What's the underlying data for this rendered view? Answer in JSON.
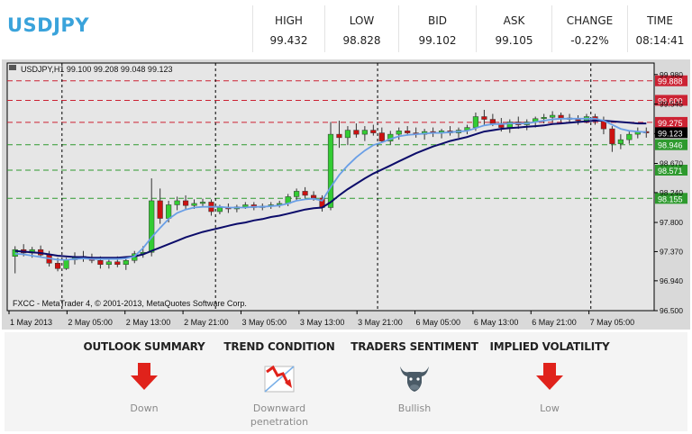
{
  "header": {
    "symbol": "USDJPY",
    "quotes": [
      {
        "label": "HIGH",
        "value": "99.432"
      },
      {
        "label": "LOW",
        "value": "98.828"
      },
      {
        "label": "BID",
        "value": "99.102"
      },
      {
        "label": "ASK",
        "value": "99.105"
      },
      {
        "label": "CHANGE",
        "value": "-0.22%"
      },
      {
        "label": "TIME",
        "value": "08:14:41"
      }
    ]
  },
  "chart_data": {
    "type": "candlestick",
    "info_line": "USDJPY,H1  99.100 99.208 99.048 99.123",
    "watermark": "FXCC - MetaTrader 4, © 2001-2013, MetaQuotes Software Corp.",
    "ylim": [
      96.5,
      100.15
    ],
    "yticks": [
      "99.980",
      "99.545",
      "99.110",
      "98.670",
      "98.240",
      "97.800",
      "97.370",
      "96.940",
      "96.500"
    ],
    "xticks": [
      "1 May 2013",
      "2 May 05:00",
      "2 May 13:00",
      "2 May 21:00",
      "3 May 05:00",
      "3 May 13:00",
      "3 May 21:00",
      "6 May 05:00",
      "6 May 13:00",
      "6 May 21:00",
      "7 May 05:00"
    ],
    "vlines": [
      "2 May 2013",
      "3 May 2013",
      "6 May 2013",
      "7 May 2013"
    ],
    "current_price": "99.123",
    "levels": [
      {
        "value": 99.888,
        "label": "99.888",
        "color": "#cc2233"
      },
      {
        "value": 99.6,
        "label": "99.600",
        "color": "#cc2233"
      },
      {
        "value": 99.275,
        "label": "99.275",
        "color": "#cc2233"
      },
      {
        "value": 98.946,
        "label": "98.946",
        "color": "#2e9a2e"
      },
      {
        "value": 98.571,
        "label": "98.571",
        "color": "#2e9a2e"
      },
      {
        "value": 98.155,
        "label": "98.155",
        "color": "#2e9a2e"
      }
    ],
    "ohlc": [
      [
        97.3,
        97.45,
        97.05,
        97.4
      ],
      [
        97.4,
        97.48,
        97.3,
        97.35
      ],
      [
        97.35,
        97.44,
        97.28,
        97.4
      ],
      [
        97.4,
        97.46,
        97.3,
        97.32
      ],
      [
        97.32,
        97.38,
        97.15,
        97.2
      ],
      [
        97.2,
        97.28,
        97.08,
        97.12
      ],
      [
        97.12,
        97.28,
        97.1,
        97.25
      ],
      [
        97.25,
        97.36,
        97.18,
        97.3
      ],
      [
        97.3,
        97.38,
        97.22,
        97.28
      ],
      [
        97.28,
        97.34,
        97.2,
        97.24
      ],
      [
        97.24,
        97.3,
        97.12,
        97.18
      ],
      [
        97.18,
        97.26,
        97.12,
        97.22
      ],
      [
        97.22,
        97.3,
        97.14,
        97.18
      ],
      [
        97.18,
        97.28,
        97.1,
        97.24
      ],
      [
        97.24,
        97.38,
        97.2,
        97.34
      ],
      [
        97.34,
        97.45,
        97.28,
        97.36
      ],
      [
        97.36,
        98.45,
        97.3,
        98.12
      ],
      [
        98.12,
        98.3,
        97.78,
        97.86
      ],
      [
        97.86,
        98.12,
        97.8,
        98.06
      ],
      [
        98.06,
        98.18,
        97.98,
        98.12
      ],
      [
        98.12,
        98.2,
        98.0,
        98.05
      ],
      [
        98.05,
        98.14,
        98.0,
        98.08
      ],
      [
        98.08,
        98.15,
        98.02,
        98.1
      ],
      [
        98.1,
        98.14,
        97.9,
        97.96
      ],
      [
        97.96,
        98.06,
        97.92,
        98.02
      ],
      [
        98.02,
        98.08,
        97.94,
        98.0
      ],
      [
        98.0,
        98.06,
        97.95,
        98.03
      ],
      [
        98.03,
        98.1,
        98.0,
        98.06
      ],
      [
        98.06,
        98.1,
        97.98,
        98.02
      ],
      [
        98.02,
        98.08,
        97.98,
        98.04
      ],
      [
        98.04,
        98.1,
        98.0,
        98.06
      ],
      [
        98.06,
        98.12,
        98.02,
        98.08
      ],
      [
        98.08,
        98.22,
        98.04,
        98.18
      ],
      [
        98.18,
        98.3,
        98.12,
        98.26
      ],
      [
        98.26,
        98.32,
        98.16,
        98.2
      ],
      [
        98.2,
        98.26,
        98.12,
        98.16
      ],
      [
        98.16,
        98.2,
        97.96,
        98.02
      ],
      [
        98.02,
        99.28,
        97.98,
        99.1
      ],
      [
        99.1,
        99.3,
        98.9,
        99.05
      ],
      [
        99.05,
        99.22,
        98.94,
        99.16
      ],
      [
        99.16,
        99.26,
        99.05,
        99.1
      ],
      [
        99.1,
        99.22,
        99.0,
        99.16
      ],
      [
        99.16,
        99.24,
        99.08,
        99.12
      ],
      [
        99.12,
        99.2,
        98.98,
        99.0
      ],
      [
        99.0,
        99.15,
        98.95,
        99.1
      ],
      [
        99.1,
        99.2,
        99.02,
        99.15
      ],
      [
        99.15,
        99.22,
        99.08,
        99.12
      ],
      [
        99.12,
        99.2,
        99.05,
        99.1
      ],
      [
        99.1,
        99.18,
        99.02,
        99.14
      ],
      [
        99.14,
        99.2,
        99.06,
        99.12
      ],
      [
        99.12,
        99.18,
        99.04,
        99.15
      ],
      [
        99.15,
        99.22,
        99.08,
        99.12
      ],
      [
        99.12,
        99.2,
        99.05,
        99.16
      ],
      [
        99.16,
        99.24,
        99.1,
        99.2
      ],
      [
        99.2,
        99.42,
        99.15,
        99.36
      ],
      [
        99.36,
        99.46,
        99.24,
        99.32
      ],
      [
        99.32,
        99.4,
        99.22,
        99.26
      ],
      [
        99.26,
        99.34,
        99.14,
        99.2
      ],
      [
        99.2,
        99.32,
        99.12,
        99.28
      ],
      [
        99.28,
        99.36,
        99.18,
        99.24
      ],
      [
        99.24,
        99.32,
        99.16,
        99.28
      ],
      [
        99.28,
        99.36,
        99.2,
        99.33
      ],
      [
        99.33,
        99.4,
        99.26,
        99.35
      ],
      [
        99.35,
        99.44,
        99.28,
        99.38
      ],
      [
        99.38,
        99.42,
        99.28,
        99.34
      ],
      [
        99.34,
        99.4,
        99.26,
        99.32
      ],
      [
        99.32,
        99.38,
        99.24,
        99.3
      ],
      [
        99.3,
        99.4,
        99.26,
        99.36
      ],
      [
        99.36,
        99.4,
        99.24,
        99.3
      ],
      [
        99.3,
        99.36,
        99.1,
        99.18
      ],
      [
        99.18,
        99.22,
        98.84,
        98.96
      ],
      [
        98.96,
        99.1,
        98.88,
        99.02
      ],
      [
        99.02,
        99.16,
        98.96,
        99.1
      ],
      [
        99.1,
        99.2,
        99.04,
        99.14
      ],
      [
        99.14,
        99.2,
        99.05,
        99.12
      ]
    ],
    "ma_fast": [
      97.34,
      97.33,
      97.31,
      97.29,
      97.27,
      97.25,
      97.25,
      97.26,
      97.27,
      97.26,
      97.26,
      97.26,
      97.26,
      97.27,
      97.3,
      97.42,
      97.58,
      97.72,
      97.85,
      97.94,
      97.99,
      98.02,
      98.03,
      98.03,
      98.03,
      98.02,
      98.02,
      98.02,
      98.03,
      98.03,
      98.04,
      98.05,
      98.08,
      98.12,
      98.14,
      98.15,
      98.12,
      98.32,
      98.5,
      98.64,
      98.76,
      98.86,
      98.94,
      98.98,
      99.03,
      99.07,
      99.09,
      99.1,
      99.11,
      99.12,
      99.12,
      99.13,
      99.14,
      99.15,
      99.19,
      99.23,
      99.25,
      99.25,
      99.26,
      99.26,
      99.26,
      99.28,
      99.3,
      99.32,
      99.33,
      99.33,
      99.33,
      99.33,
      99.33,
      99.3,
      99.24,
      99.18,
      99.15,
      99.14,
      99.13
    ],
    "ma_slow": [
      97.38,
      97.37,
      97.36,
      97.35,
      97.33,
      97.31,
      97.3,
      97.29,
      97.29,
      97.28,
      97.28,
      97.28,
      97.28,
      97.29,
      97.3,
      97.33,
      97.38,
      97.43,
      97.48,
      97.53,
      97.58,
      97.62,
      97.66,
      97.69,
      97.72,
      97.75,
      97.78,
      97.8,
      97.83,
      97.85,
      97.88,
      97.9,
      97.93,
      97.96,
      97.99,
      98.01,
      98.02,
      98.1,
      98.2,
      98.29,
      98.37,
      98.45,
      98.52,
      98.58,
      98.64,
      98.7,
      98.76,
      98.82,
      98.87,
      98.92,
      98.96,
      99.0,
      99.03,
      99.06,
      99.1,
      99.14,
      99.16,
      99.18,
      99.19,
      99.2,
      99.21,
      99.22,
      99.23,
      99.25,
      99.26,
      99.27,
      99.28,
      99.29,
      99.3,
      99.3,
      99.29,
      99.28,
      99.27,
      99.26,
      99.26
    ]
  },
  "summary": [
    {
      "title": "OUTLOOK SUMMARY",
      "value": "Down",
      "icon": "down-arrow-icon"
    },
    {
      "title": "TREND CONDITION",
      "value": "Downward penetration",
      "icon": "downtrend-icon"
    },
    {
      "title": "TRADERS SENTIMENT",
      "value": "Bullish",
      "icon": "bull-icon"
    },
    {
      "title": "IMPLIED VOLATILITY",
      "value": "Low",
      "icon": "down-arrow-icon"
    }
  ],
  "colors": {
    "accent": "#3aa3db",
    "chart_bg": "#d9d9d9",
    "bull_candle": "#33cc33",
    "bear_candle": "#cc1111",
    "ma_fast": "#6a9fe6",
    "ma_slow": "#0c0c6a",
    "arrow_red": "#e0221b"
  }
}
